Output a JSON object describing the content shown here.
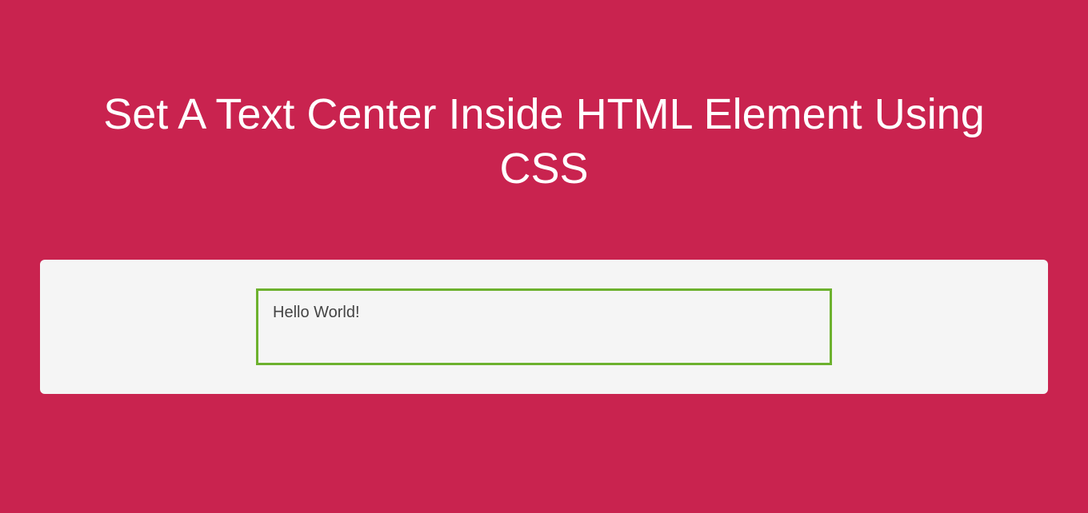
{
  "title": "Set A Text Center Inside HTML Element Using CSS",
  "box": {
    "text": "Hello World!"
  }
}
